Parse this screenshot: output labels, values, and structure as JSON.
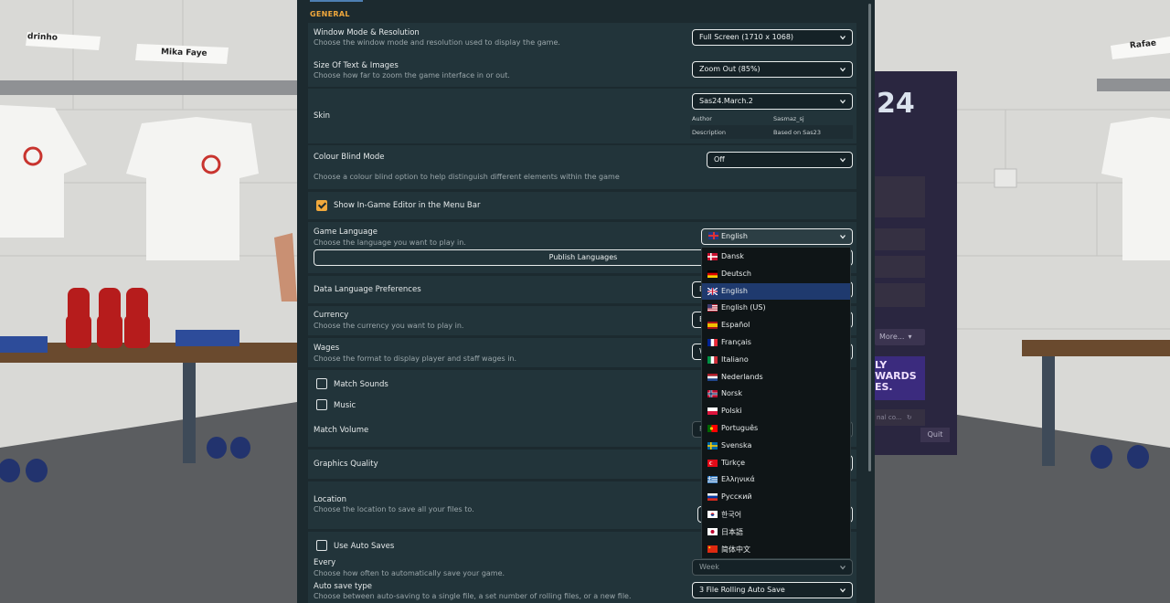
{
  "background": {
    "nameplates": [
      "drinho",
      "Mika Faye",
      "Rafae"
    ],
    "side_menu": {
      "more_label": "More...",
      "poster_text": [
        "LY",
        "WARDS",
        "ES."
      ],
      "field_placeholder": "nal co...",
      "quit_label": "Quit",
      "year": "24"
    }
  },
  "colors": {
    "panel_bg": "#1c2a2f",
    "row_bg": "#22343a",
    "accent": "#f0a83c",
    "selected": "#1f3a6e"
  },
  "settings": {
    "section_title": "GENERAL",
    "window_mode": {
      "label": "Window Mode & Resolution",
      "desc": "Choose the window mode and resolution used to display the game.",
      "value": "Full Screen (1710 x 1068)"
    },
    "zoom": {
      "label": "Size Of Text & Images",
      "desc": "Choose how far to zoom the game interface in or out.",
      "value": "Zoom Out (85%)"
    },
    "skin": {
      "label": "Skin",
      "value": "Sas24.March.2",
      "author_key": "Author",
      "author_value": "Sasmaz_sj",
      "desc_key": "Description",
      "desc_value": "Based on Sas23"
    },
    "colour_blind": {
      "label": "Colour Blind Mode",
      "desc": "Choose a colour blind option to help distinguish different elements within the game",
      "value": "Off"
    },
    "in_game_editor": {
      "label": "Show In-Game Editor in the Menu Bar",
      "checked": true
    },
    "language": {
      "label": "Game Language",
      "desc": "Choose the language you want to play in.",
      "value": "English",
      "publish_label": "Publish Languages"
    },
    "data_language": {
      "label": "Data Language Preferences",
      "value_fragment": "D"
    },
    "currency": {
      "label": "Currency",
      "desc": "Choose the currency you want to play in.",
      "value_fragment": "E"
    },
    "wages": {
      "label": "Wages",
      "desc": "Choose the format to display player and staff wages in.",
      "value_fragment": "W"
    },
    "match_sounds": {
      "label": "Match Sounds",
      "checked": false
    },
    "music": {
      "label": "Music",
      "checked": false
    },
    "match_volume": {
      "label": "Match Volume",
      "value_fragment": "F"
    },
    "graphics": {
      "label": "Graphics Quality"
    },
    "location": {
      "label": "Location",
      "desc": "Choose the location to save all your files to."
    },
    "auto_saves": {
      "label": "Use Auto Saves",
      "checked": false
    },
    "every": {
      "label": "Every",
      "desc": "Choose how often to automatically save your game.",
      "value": "Week"
    },
    "auto_save_type": {
      "label": "Auto save type",
      "desc": "Choose between auto-saving to a single file, a set number of rolling files, or a new file.",
      "value": "3 File Rolling Auto Save"
    }
  },
  "language_menu": {
    "selected": "English",
    "items": [
      {
        "label": "Dansk",
        "flag": "dk"
      },
      {
        "label": "Deutsch",
        "flag": "de"
      },
      {
        "label": "English",
        "flag": "gb"
      },
      {
        "label": "English (US)",
        "flag": "us"
      },
      {
        "label": "Español",
        "flag": "es"
      },
      {
        "label": "Français",
        "flag": "fr"
      },
      {
        "label": "Italiano",
        "flag": "it"
      },
      {
        "label": "Nederlands",
        "flag": "nl"
      },
      {
        "label": "Norsk",
        "flag": "no"
      },
      {
        "label": "Polski",
        "flag": "pl"
      },
      {
        "label": "Português",
        "flag": "pt"
      },
      {
        "label": "Svenska",
        "flag": "se"
      },
      {
        "label": "Türkçe",
        "flag": "tr"
      },
      {
        "label": "Ελληνικά",
        "flag": "gr"
      },
      {
        "label": "Русский",
        "flag": "ru"
      },
      {
        "label": "한국어",
        "flag": "kr"
      },
      {
        "label": "日本語",
        "flag": "jp"
      },
      {
        "label": "简体中文",
        "flag": "cn"
      }
    ]
  }
}
